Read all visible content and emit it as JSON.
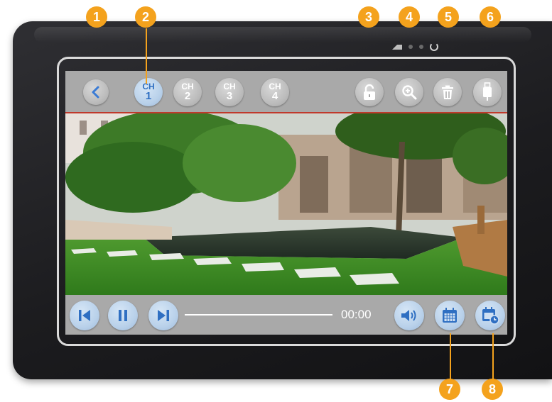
{
  "device": {
    "topbar": {
      "back_icon": "back-chevron-icon",
      "channels": [
        {
          "prefix": "CH",
          "num": "1",
          "state": "active"
        },
        {
          "prefix": "CH",
          "num": "2",
          "state": "inactive"
        },
        {
          "prefix": "CH",
          "num": "3",
          "state": "inactive"
        },
        {
          "prefix": "CH",
          "num": "4",
          "state": "inactive"
        }
      ],
      "right_icons": [
        "lock-icon",
        "zoom-in-icon",
        "trash-icon",
        "usb-icon"
      ]
    },
    "bottombar": {
      "controls": [
        "previous-icon",
        "pause-icon",
        "next-icon"
      ],
      "playback_progress": 0,
      "time": "00:00",
      "right_icons": [
        "volume-icon",
        "calendar-icon",
        "schedule-calendar-icon"
      ]
    },
    "status_leds": [
      "signal-icon",
      "indicator-led",
      "indicator-led",
      "power-icon"
    ]
  },
  "callouts": [
    "1",
    "2",
    "3",
    "4",
    "5",
    "6",
    "7",
    "8"
  ],
  "colors": {
    "accent_blue": "#3a7bd5",
    "callout_orange": "#f4a21d",
    "bar_gray": "#a9a9a9",
    "device_black": "#1c1c1f"
  }
}
